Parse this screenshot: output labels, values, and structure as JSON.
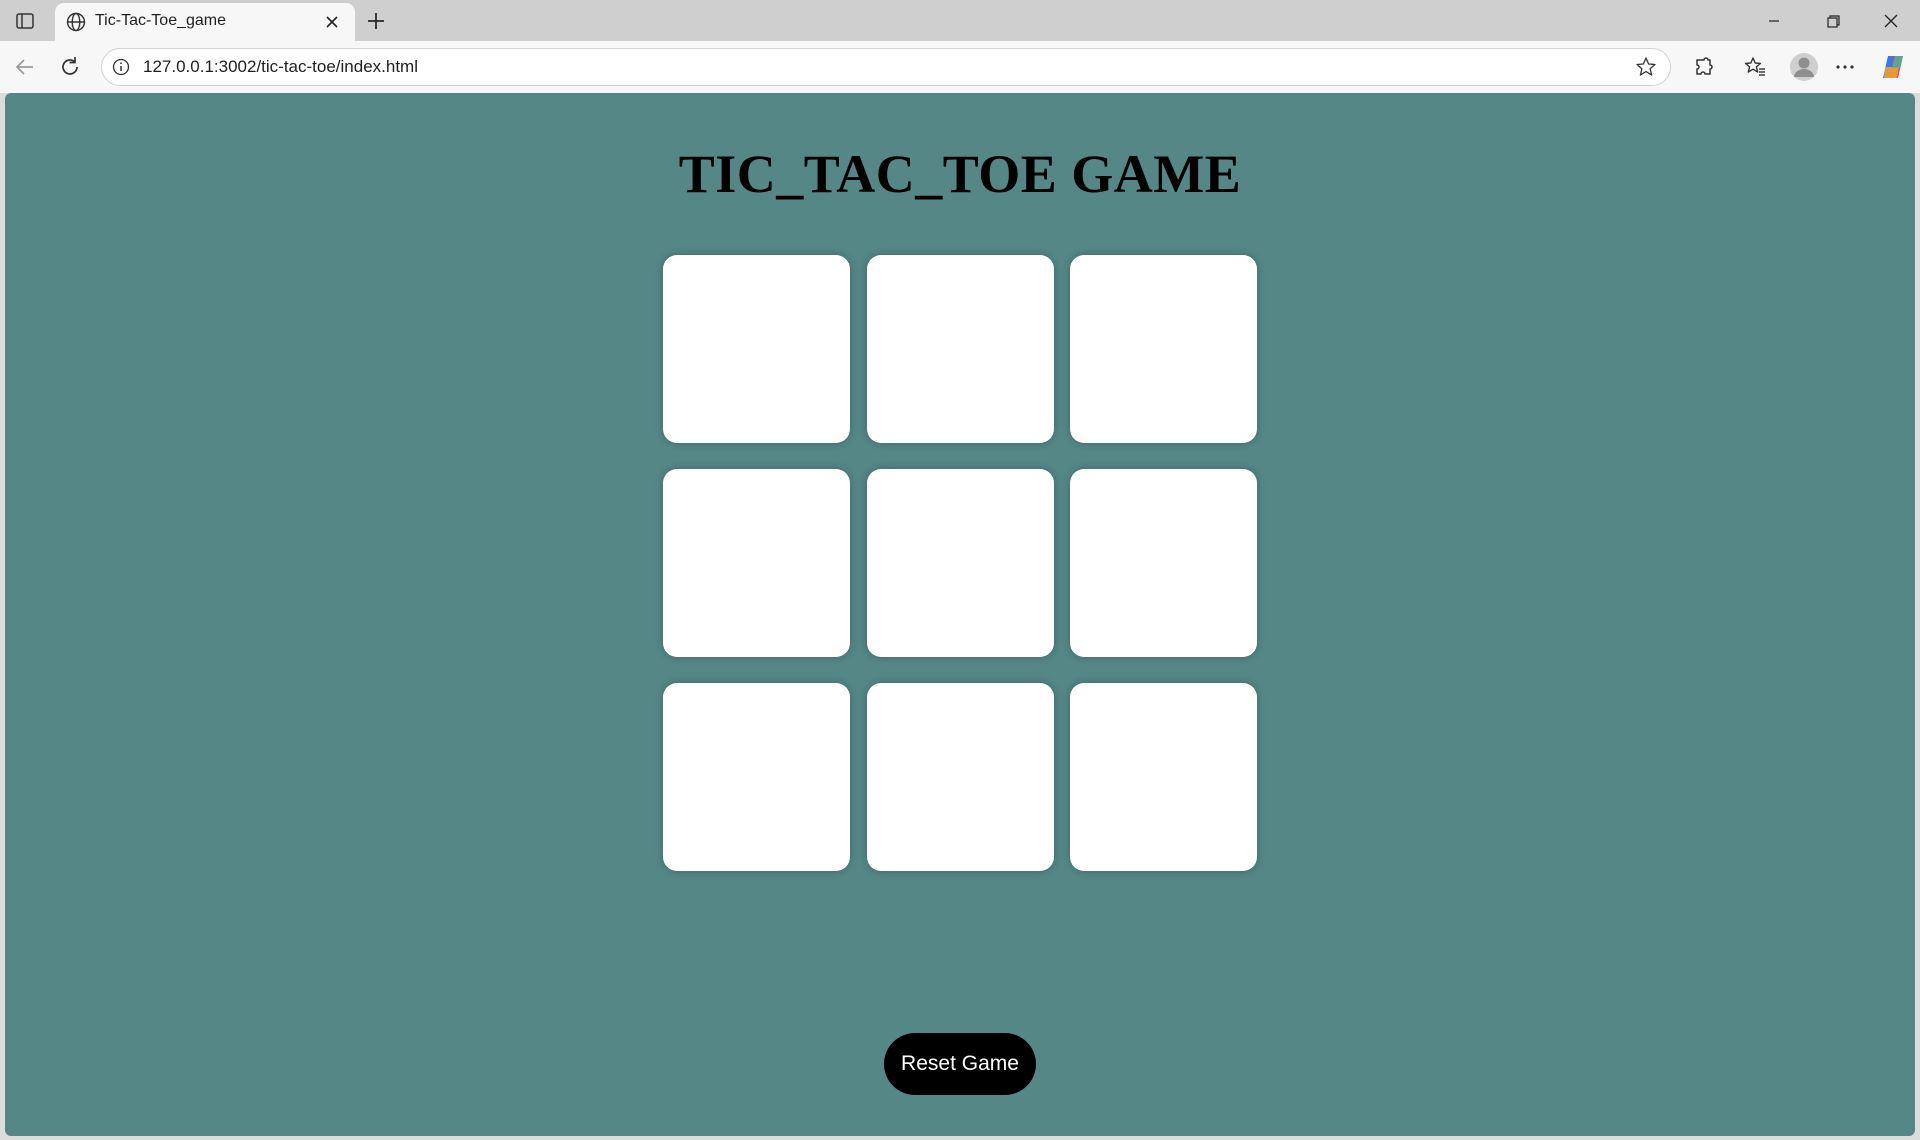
{
  "browser": {
    "tab": {
      "title": "Tic-Tac-Toe_game",
      "favicon": "globe-icon"
    },
    "address": {
      "url": "127.0.0.1:3002/tic-tac-toe/index.html"
    },
    "toolbar_icons": [
      "back-icon",
      "refresh-icon",
      "info-icon",
      "favorite-star-icon",
      "extensions-icon",
      "favorites-icon",
      "profile-icon",
      "more-icon",
      "copilot-icon"
    ],
    "window_controls": [
      "minimize-icon",
      "restore-icon",
      "close-icon"
    ]
  },
  "page": {
    "title": "TIC_TAC_TOE GAME",
    "background_color": "#548786",
    "board": {
      "cells": [
        "",
        "",
        "",
        "",
        "",
        "",
        "",
        "",
        ""
      ]
    },
    "reset_button": {
      "label": "Reset Game"
    }
  }
}
